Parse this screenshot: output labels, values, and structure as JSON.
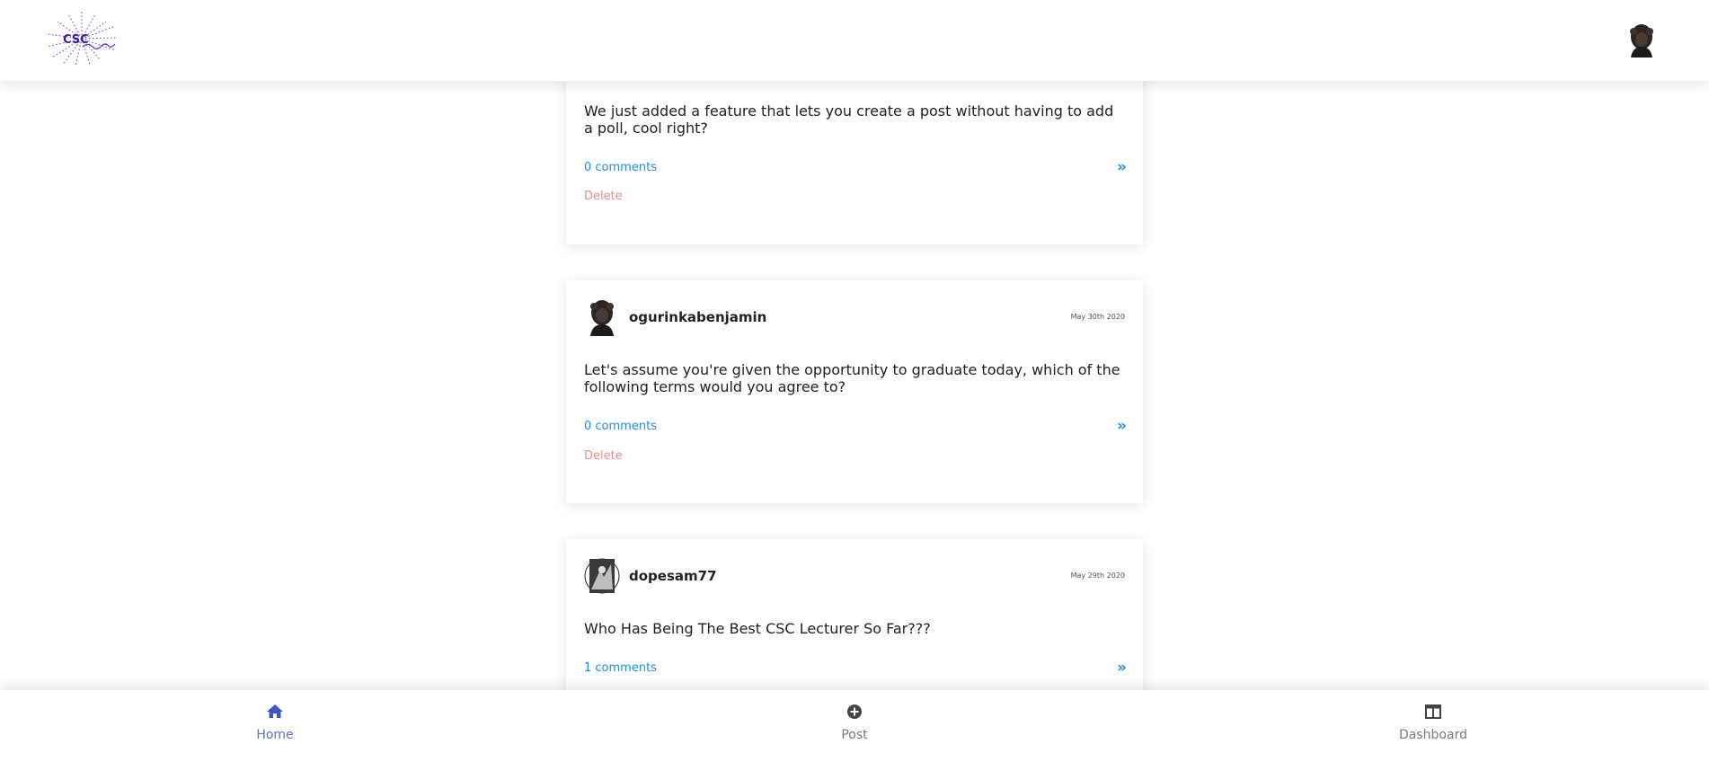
{
  "header": {
    "logo_text": "CSC"
  },
  "posts": [
    {
      "body": "We just added a feature that lets you create a post without having to add a poll, cool right?",
      "comments_label": "0 comments",
      "delete_label": "Delete",
      "open_label": "»"
    },
    {
      "username": "ogurinkabenjamin",
      "date": "May 30th 2020",
      "body": "Let's assume you're given the opportunity to graduate today, which of the following terms would you agree to?",
      "comments_label": "0 comments",
      "delete_label": "Delete",
      "open_label": "»"
    },
    {
      "username": "dopesam77",
      "date": "May 29th 2020",
      "body": "Who Has Being The Best CSC Lecturer So Far???",
      "comments_label": "1 comments",
      "open_label": "»"
    }
  ],
  "bottom_nav": {
    "items": [
      {
        "label": "Home",
        "icon": "home-icon",
        "active": true
      },
      {
        "label": "Post",
        "icon": "plus-circle-icon",
        "active": false
      },
      {
        "label": "Dashboard",
        "icon": "dashboard-icon",
        "active": false
      }
    ]
  },
  "colors": {
    "link": "#1a8fe0",
    "delete": "#f08a8a",
    "active_nav": "#5b6fd6",
    "logo": "#5a2dbf"
  }
}
